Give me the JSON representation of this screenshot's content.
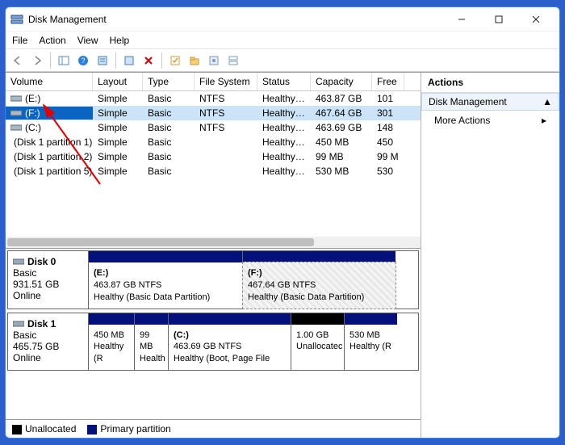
{
  "window": {
    "title": "Disk Management",
    "min_tooltip": "Minimize",
    "max_tooltip": "Maximize",
    "close_tooltip": "Close"
  },
  "menu": {
    "file": "File",
    "action": "Action",
    "view": "View",
    "help": "Help"
  },
  "toolbar_icons": [
    "back-icon",
    "forward-icon",
    "show-hide-tree-icon",
    "help-icon",
    "properties-icon",
    "refresh-icon",
    "delete-icon",
    "checklist-icon",
    "new-icon",
    "settings-icon",
    "layout-icon"
  ],
  "columns": {
    "volume": "Volume",
    "layout": "Layout",
    "type": "Type",
    "fs": "File System",
    "status": "Status",
    "capacity": "Capacity",
    "free": "Free"
  },
  "volumes": [
    {
      "name": "(E:)",
      "layout": "Simple",
      "type": "Basic",
      "fs": "NTFS",
      "status": "Healthy (B...",
      "capacity": "463.87 GB",
      "free": "101",
      "selected": false
    },
    {
      "name": "(F:)",
      "layout": "Simple",
      "type": "Basic",
      "fs": "NTFS",
      "status": "Healthy (B...",
      "capacity": "467.64 GB",
      "free": "301",
      "selected": true
    },
    {
      "name": "(C:)",
      "layout": "Simple",
      "type": "Basic",
      "fs": "NTFS",
      "status": "Healthy (B...",
      "capacity": "463.69 GB",
      "free": "148",
      "selected": false
    },
    {
      "name": "(Disk 1 partition 1)",
      "layout": "Simple",
      "type": "Basic",
      "fs": "",
      "status": "Healthy (R...",
      "capacity": "450 MB",
      "free": "450",
      "selected": false
    },
    {
      "name": "(Disk 1 partition 2)",
      "layout": "Simple",
      "type": "Basic",
      "fs": "",
      "status": "Healthy (E...",
      "capacity": "99 MB",
      "free": "99 M",
      "selected": false
    },
    {
      "name": "(Disk 1 partition 5)",
      "layout": "Simple",
      "type": "Basic",
      "fs": "",
      "status": "Healthy (R...",
      "capacity": "530 MB",
      "free": "530",
      "selected": false
    }
  ],
  "disk0": {
    "name": "Disk 0",
    "type": "Basic",
    "size": "931.51 GB",
    "state": "Online",
    "parts": [
      {
        "name": "(E:)",
        "line2": "463.87 GB NTFS",
        "line3": "Healthy (Basic Data Partition)",
        "band": "primary",
        "width": 190,
        "selected": false
      },
      {
        "name": "(F:)",
        "line2": "467.64 GB NTFS",
        "line3": "Healthy (Basic Data Partition)",
        "band": "primary",
        "width": 190,
        "selected": true
      }
    ]
  },
  "disk1": {
    "name": "Disk 1",
    "type": "Basic",
    "size": "465.75 GB",
    "state": "Online",
    "parts": [
      {
        "name": "",
        "line2": "450 MB",
        "line3": "Healthy (R",
        "band": "primary",
        "width": 56
      },
      {
        "name": "",
        "line2": "99 MB",
        "line3": "Health",
        "band": "primary",
        "width": 42
      },
      {
        "name": "(C:)",
        "line2": "463.69 GB NTFS",
        "line3": "Healthy (Boot, Page File",
        "band": "primary",
        "width": 152
      },
      {
        "name": "",
        "line2": "1.00 GB",
        "line3": "Unallocatec",
        "band": "unallocated",
        "width": 66
      },
      {
        "name": "",
        "line2": "530 MB",
        "line3": "Healthy (R",
        "band": "primary",
        "width": 66
      }
    ]
  },
  "legend": {
    "unallocated": "Unallocated",
    "primary": "Primary partition"
  },
  "actions_pane": {
    "header": "Actions",
    "group": "Disk Management",
    "more": "More Actions"
  }
}
